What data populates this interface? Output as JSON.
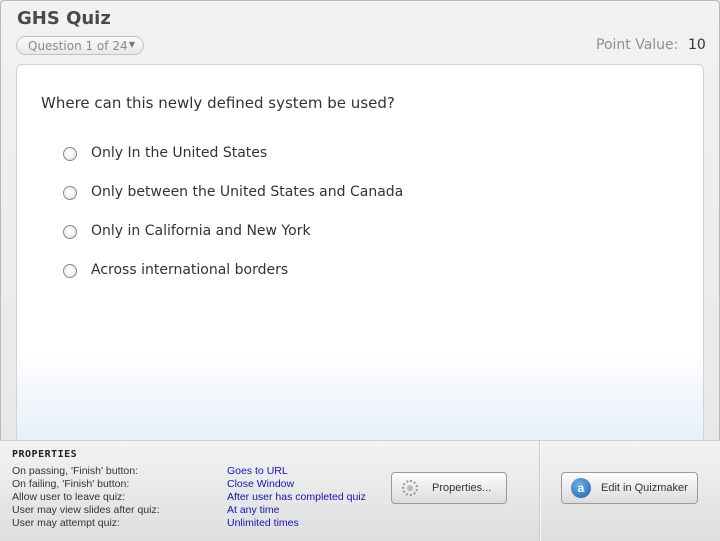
{
  "header": {
    "title": "GHS Quiz",
    "question_selector": "Question 1 of 24",
    "point_value_label": "Point Value:",
    "point_value": "10"
  },
  "question": {
    "text": "Where can this newly defined system be used?",
    "options": [
      {
        "label": "Only In the United States",
        "selected": false
      },
      {
        "label": "Only between the United States and Canada",
        "selected": false
      },
      {
        "label": "Only in California and New York",
        "selected": false
      },
      {
        "label": "Across international borders",
        "selected": false
      }
    ]
  },
  "properties": {
    "title": "PROPERTIES",
    "rows": [
      {
        "label": "On passing, 'Finish' button:",
        "value": "Goes to URL"
      },
      {
        "label": "On failing, 'Finish' button:",
        "value": "Close Window"
      },
      {
        "label": "Allow user to leave quiz:",
        "value": "After user has completed quiz"
      },
      {
        "label": "User may view slides after quiz:",
        "value": "At any time"
      },
      {
        "label": "User may attempt quiz:",
        "value": "Unlimited times"
      }
    ],
    "properties_button": "Properties...",
    "edit_button": "Edit in Quizmaker"
  },
  "icons": {
    "dropdown": "chevron-down-icon",
    "properties": "gear-icon",
    "quizmaker": "quizmaker-icon"
  },
  "colors": {
    "property_value": "#1414b8"
  }
}
